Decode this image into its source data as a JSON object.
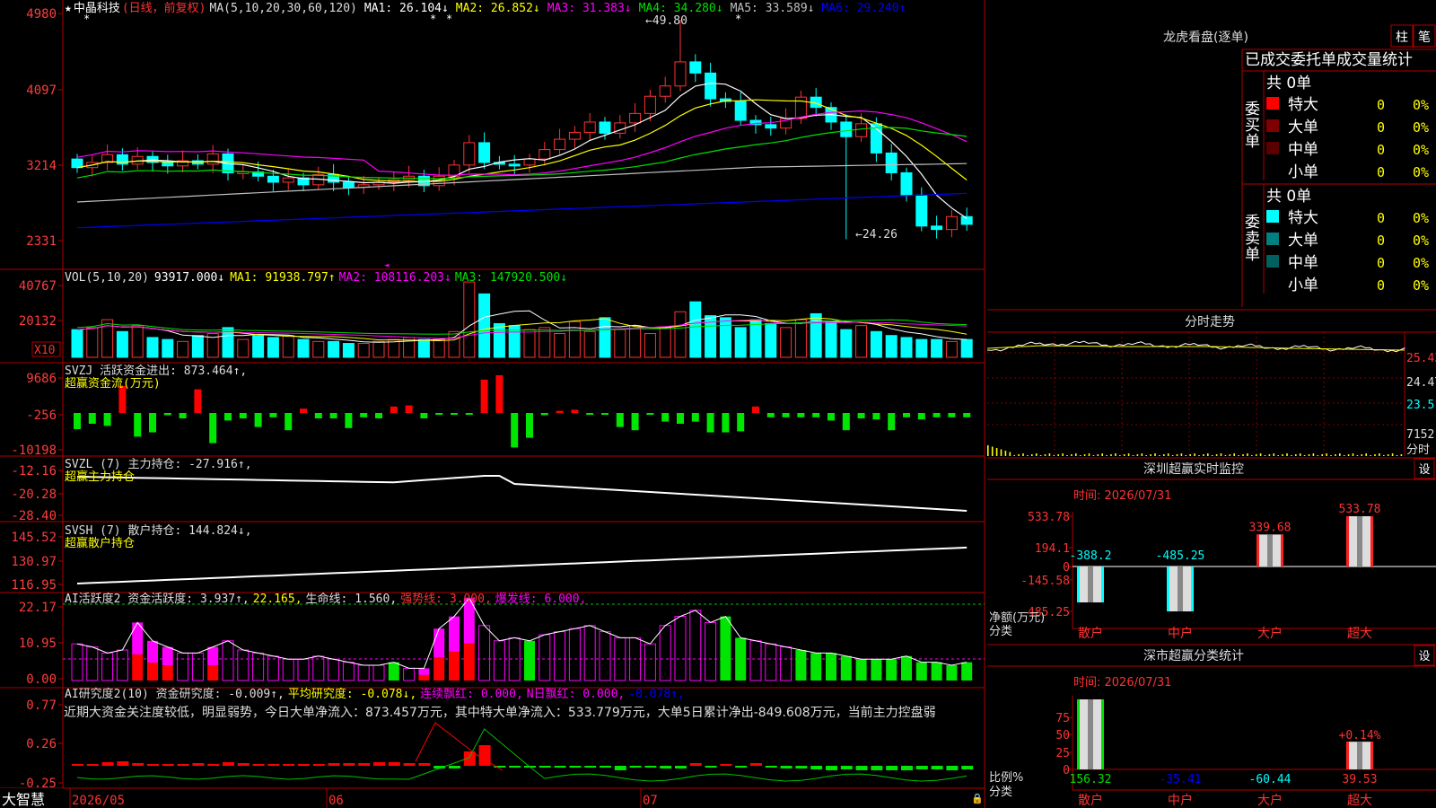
{
  "colors": {
    "up": "#ff3232",
    "down": "#00ffff",
    "frame": "#b00000",
    "bg": "#000000",
    "ma1": "#ffffff",
    "ma2": "#ffff00",
    "ma3": "#ff00ff",
    "ma4": "#00e000",
    "ma5": "#c0c0c0",
    "ma6": "#0000ff",
    "green_bar": "#00e600",
    "magenta_bar": "#ff00ff",
    "yellow": "#ffff00"
  },
  "main": {
    "star": "★",
    "stock_name": "中晶科技",
    "period": "(日线，前复权)",
    "ma_label": "MA(5,10,20,30,60,120)",
    "ma_values": [
      {
        "label": "MA1: 26.104↓",
        "color": "#ffffff"
      },
      {
        "label": "MA2: 26.852↓",
        "color": "#ffff00"
      },
      {
        "label": "MA3: 31.383↓",
        "color": "#ff00ff"
      },
      {
        "label": "MA4: 34.280↓",
        "color": "#00e000"
      },
      {
        "label": "MA5: 33.589↓",
        "color": "#c0c0c0"
      },
      {
        "label": "MA6: 29.240↑",
        "color": "#0000ff"
      }
    ],
    "y_ticks": [
      "4980",
      "4097",
      "3214",
      "2331"
    ],
    "high_note": "←49.80",
    "low_note": "←24.26"
  },
  "vol": {
    "title": "VOL(5,10,20)",
    "value": "93917.000↓",
    "ma1": "MA1: 91938.797↑",
    "ma2": "MA2: 108116.203↓",
    "ma3": "MA3: 147920.500↓",
    "y_ticks": [
      "40767",
      "20132"
    ],
    "unit": "X10"
  },
  "svzj": {
    "title": "SVZJ  活跃资金进出: 873.464↑,",
    "subtitle": "超赢资金流(万元)",
    "y_ticks": [
      "9686",
      "-256",
      "-10198"
    ]
  },
  "svzl": {
    "title": "SVZL (7) 主力持仓: -27.916↑,",
    "subtitle": "超赢主力持仓",
    "y_ticks": [
      "-12.16",
      "-20.28",
      "-28.40"
    ]
  },
  "svsh": {
    "title": "SVSH (7) 散户持仓: 144.824↓,",
    "subtitle": "超赢散户持仓",
    "y_ticks": [
      "145.52",
      "130.97",
      "116.95"
    ]
  },
  "ai1": {
    "title": "AI活跃度2 资金活跃度: 3.937↑,",
    "v2": "22.165,",
    "v3": "生命线: 1.560,",
    "v4": "强势线: 3.000,",
    "v5": "爆发线: 6.000,",
    "y_ticks": [
      "22.17",
      "10.95",
      "0.00"
    ]
  },
  "ai2": {
    "title": "AI研究度2(10) 资金研究度: -0.009↑,",
    "v2": "平均研究度: -0.078↓,",
    "v3": "连续飘红: 0.000,",
    "v4": "N日飘红: 0.000,",
    "v5": "-0.078↑,",
    "comment": "近期大资金关注度较低，明显弱势，今日大单净流入：873.457万元，其中特大单净流入：533.779万元，大单5日累计净出-849.608万元，当前主力控盘弱",
    "y_ticks": [
      "0.77",
      "0.26",
      "-0.25"
    ]
  },
  "xaxis": {
    "labels": [
      "2026/05",
      "06",
      "07"
    ]
  },
  "brand": "大智慧",
  "right": {
    "dragon_title": "龙虎看盘(逐单)",
    "btn_zhu": "柱",
    "btn_bi": "笔",
    "stats_title": "已成交委托单成交量统计",
    "buy": {
      "side": "委买单",
      "total": "共 0单",
      "rows": [
        {
          "name": "特大",
          "n": "0",
          "pct": "0%",
          "color": "#ff0000"
        },
        {
          "name": "大单",
          "n": "0",
          "pct": "0%",
          "color": "#7f0000"
        },
        {
          "name": "中单",
          "n": "0",
          "pct": "0%",
          "color": "#5a0000"
        },
        {
          "name": "小单",
          "n": "0",
          "pct": "0%",
          "color": ""
        }
      ]
    },
    "sell": {
      "side": "委卖单",
      "total": "共 0单",
      "rows": [
        {
          "name": "特大",
          "n": "0",
          "pct": "0%",
          "color": "#00ffff"
        },
        {
          "name": "大单",
          "n": "0",
          "pct": "0%",
          "color": "#008080"
        },
        {
          "name": "中单",
          "n": "0",
          "pct": "0%",
          "color": "#006060"
        },
        {
          "name": "小单",
          "n": "0",
          "pct": "0%",
          "color": ""
        }
      ]
    },
    "intraday_title": "分时走势",
    "intraday_ticks": [
      "25.43",
      "24.47",
      "23.51",
      "7152"
    ],
    "intraday_unit": "分时",
    "sz_title": "深圳超赢实时监控",
    "sz_time": "时间: 2026/07/31",
    "sz_btn": "设",
    "sz_y": [
      "533.78",
      "194.1",
      "0",
      "-145.58",
      "-485.25"
    ],
    "sz_unit": "净额(万元)",
    "sz_cat_label": "分类",
    "sz_bars": [
      {
        "cat": "散户",
        "value": -388.2,
        "label": "-388.2"
      },
      {
        "cat": "中户",
        "value": -485.25,
        "label": "-485.25"
      },
      {
        "cat": "大户",
        "value": 339.68,
        "label": "339.68"
      },
      {
        "cat": "超大",
        "value": 533.78,
        "label": "533.78"
      }
    ],
    "sc_title": "深市超赢分类统计",
    "sc_time": "时间: 2026/07/31",
    "sc_btn": "设",
    "sc_y": [
      "75",
      "50",
      "25",
      "0"
    ],
    "sc_unit": "比例%",
    "sc_cat_label": "分类",
    "sc_bars": [
      {
        "cat": "散户",
        "value": 100,
        "label": "156.32"
      },
      {
        "cat": "中户",
        "value": 0,
        "label": "-35.41"
      },
      {
        "cat": "大户",
        "value": 0,
        "label": "-60.44"
      },
      {
        "cat": "超大",
        "value": 39.53,
        "label": "39.53",
        "pct": "+0.14%"
      }
    ]
  }
}
